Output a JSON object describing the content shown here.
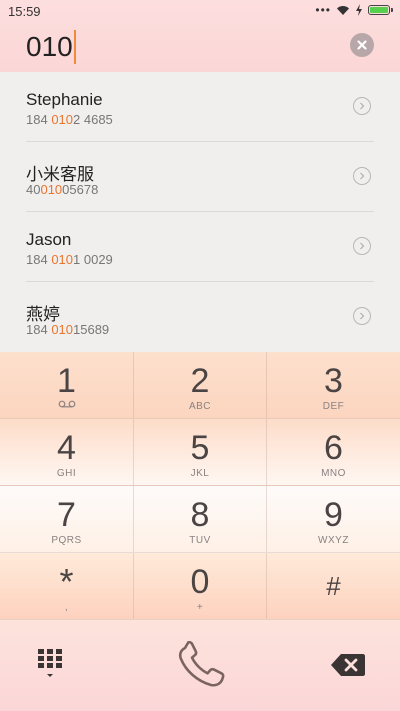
{
  "status_bar": {
    "time": "15:59",
    "signal_dots": "•••",
    "icons": [
      "wifi-icon",
      "charging-bolt-icon",
      "battery-icon"
    ]
  },
  "dialer": {
    "input_value": "010"
  },
  "contacts": [
    {
      "name": "Stephanie",
      "number_pre": "184 ",
      "number_hl": "010",
      "number_post": "2 4685"
    },
    {
      "name": "小米客服",
      "number_pre": "40",
      "number_hl": "010",
      "number_post": "05678"
    },
    {
      "name": "Jason",
      "number_pre": "184 ",
      "number_hl": "010",
      "number_post": "1 0029"
    },
    {
      "name": "燕婷",
      "number_pre": "184 ",
      "number_hl": "010",
      "number_post": "15689"
    }
  ],
  "keypad": {
    "keys": [
      {
        "digit": "1",
        "letters": ""
      },
      {
        "digit": "2",
        "letters": "ABC"
      },
      {
        "digit": "3",
        "letters": "DEF"
      },
      {
        "digit": "4",
        "letters": "GHI"
      },
      {
        "digit": "5",
        "letters": "JKL"
      },
      {
        "digit": "6",
        "letters": "MNO"
      },
      {
        "digit": "7",
        "letters": "PQRS"
      },
      {
        "digit": "8",
        "letters": "TUV"
      },
      {
        "digit": "9",
        "letters": "WXYZ"
      },
      {
        "digit": "*",
        "letters": ","
      },
      {
        "digit": "0",
        "letters": "+"
      },
      {
        "digit": "#",
        "letters": ""
      }
    ]
  },
  "colors": {
    "highlight": "#e9752f",
    "caret": "#f08a3c",
    "battery": "#56d04c"
  }
}
